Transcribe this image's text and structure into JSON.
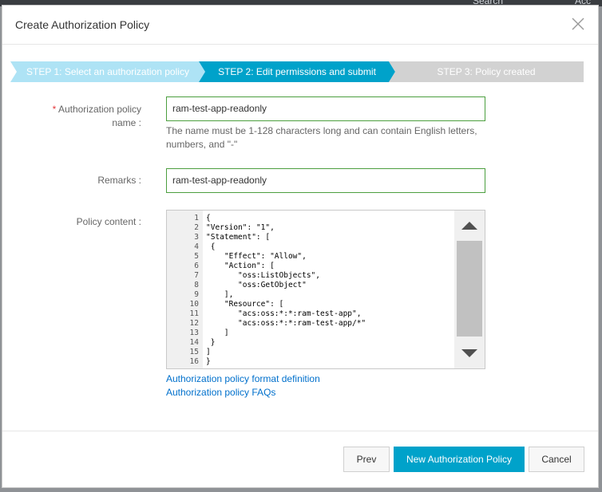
{
  "background_peek": {
    "search": "Search",
    "account": "Acc"
  },
  "modal": {
    "title": "Create Authorization Policy"
  },
  "steps": [
    {
      "label": "STEP 1: Select an authorization policy",
      "state": "done"
    },
    {
      "label": "STEP 2: Edit permissions and submit",
      "state": "active"
    },
    {
      "label": "STEP 3: Policy created",
      "state": "pending"
    }
  ],
  "form": {
    "name_label_required": "*",
    "name_label_line1": "Authorization policy",
    "name_label_line2": "name :",
    "name_value": "ram-test-app-readonly",
    "name_hint_line1": "The name must be 1-128 characters long and can contain English letters,",
    "name_hint_line2": "numbers, and \"-\"",
    "remarks_label": "Remarks :",
    "remarks_value": "ram-test-app-readonly",
    "content_label": "Policy content :"
  },
  "editor": {
    "lines": [
      {
        "n": "1",
        "text": "{"
      },
      {
        "n": "2",
        "text": "\"Version\": \"1\","
      },
      {
        "n": "3",
        "text": "\"Statement\": ["
      },
      {
        "n": "4",
        "text": " {"
      },
      {
        "n": "5",
        "text": "    \"Effect\": \"Allow\","
      },
      {
        "n": "6",
        "text": "    \"Action\": ["
      },
      {
        "n": "7",
        "text": "       \"oss:ListObjects\","
      },
      {
        "n": "8",
        "text": "       \"oss:GetObject\""
      },
      {
        "n": "9",
        "text": "    ],"
      },
      {
        "n": "10",
        "text": "    \"Resource\": ["
      },
      {
        "n": "11",
        "text": "       \"acs:oss:*:*:ram-test-app\","
      },
      {
        "n": "12",
        "text": "       \"acs:oss:*:*:ram-test-app/*\""
      },
      {
        "n": "13",
        "text": "    ]"
      },
      {
        "n": "14",
        "text": " }"
      },
      {
        "n": "15",
        "text": "]"
      },
      {
        "n": "16",
        "text": "}"
      }
    ]
  },
  "links": {
    "format_definition": "Authorization policy format definition",
    "faqs": "Authorization policy FAQs"
  },
  "buttons": {
    "prev": "Prev",
    "new_policy": "New Authorization Policy",
    "cancel": "Cancel"
  },
  "colors": {
    "accent": "#00a2ca",
    "step_done": "#aee3f5",
    "step_pending": "#d2d2d2",
    "input_border": "#4c9f3f",
    "link": "#0070cc",
    "required": "#e4393c"
  }
}
